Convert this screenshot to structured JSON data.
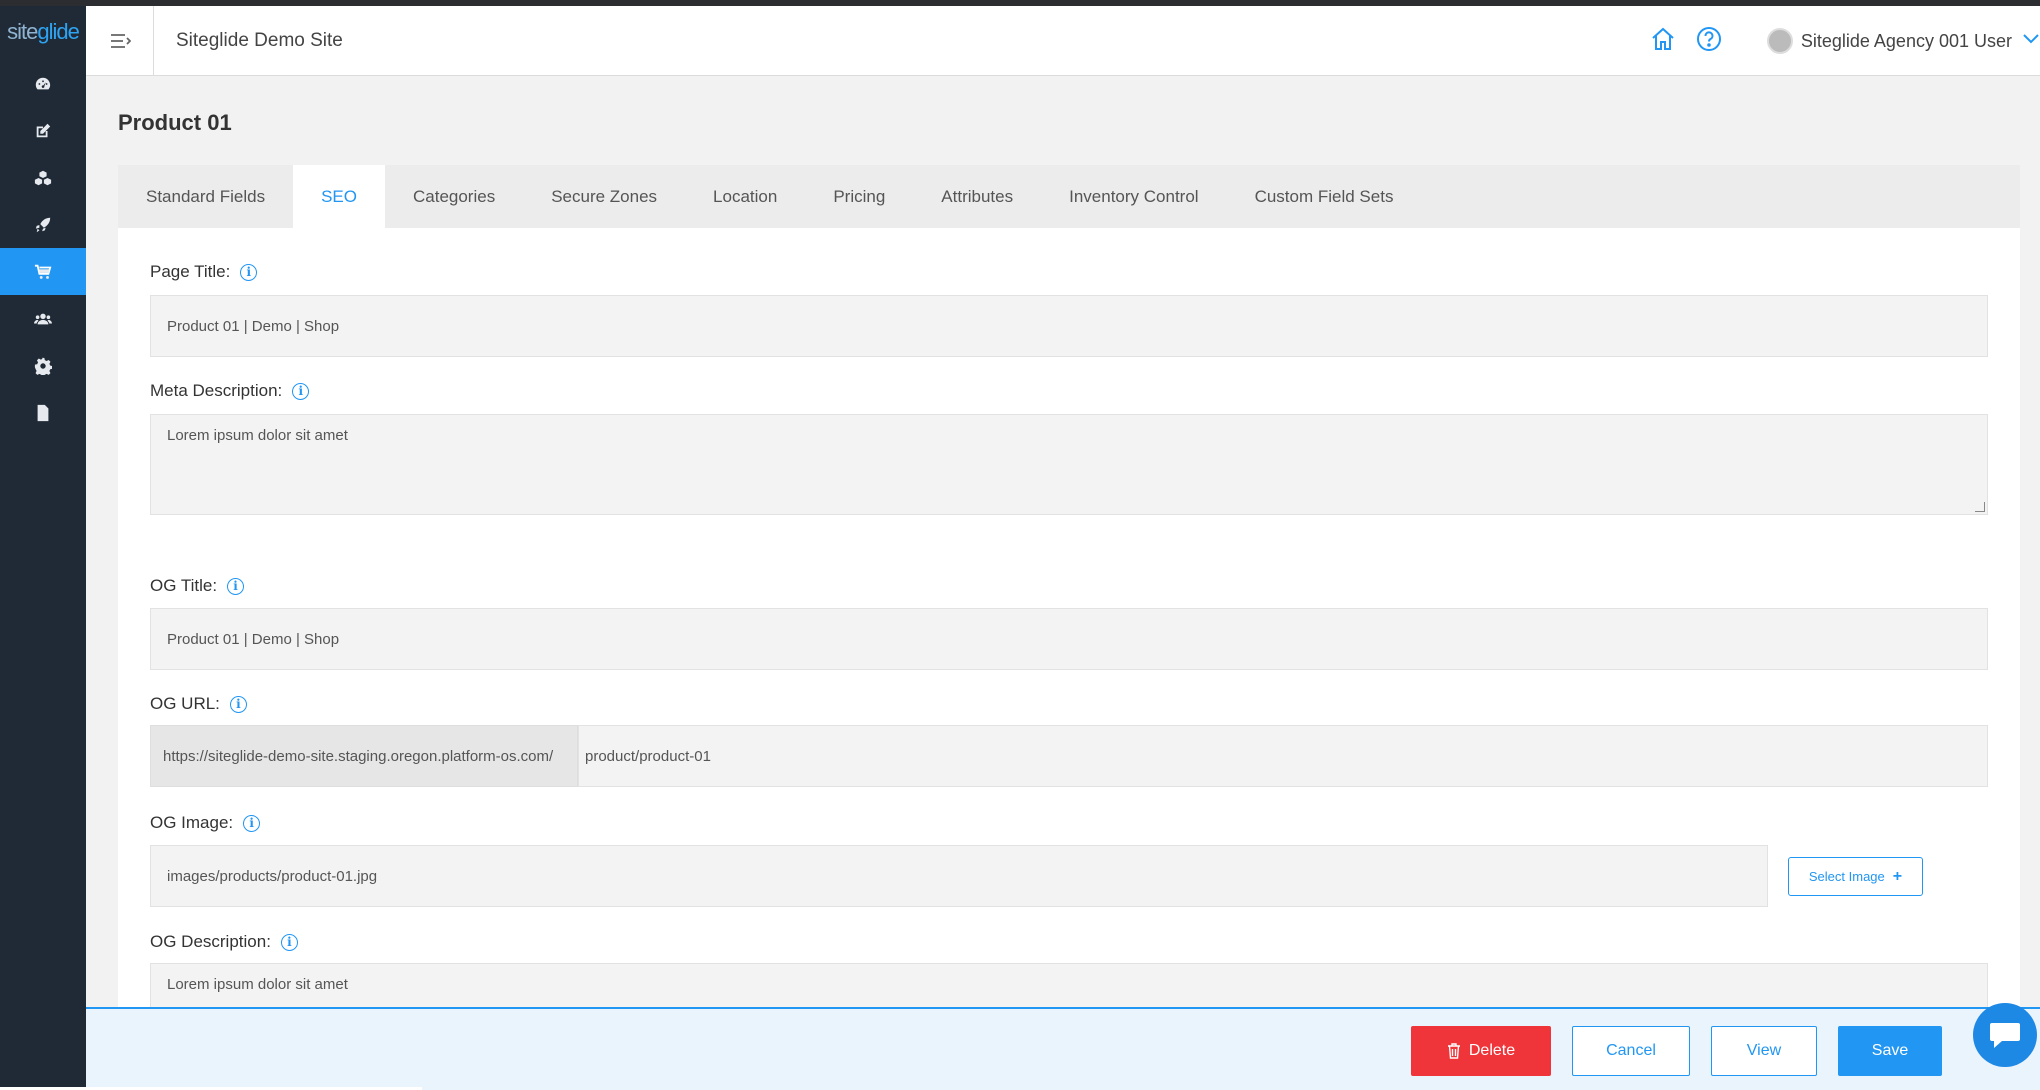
{
  "header": {
    "site_name": "Siteglide Demo Site",
    "user_name": "Siteglide Agency 001 User"
  },
  "logo": {
    "part1": "site",
    "part2": "glide"
  },
  "sidebar": {
    "items": [
      {
        "icon": "dashboard-icon"
      },
      {
        "icon": "edit-icon"
      },
      {
        "icon": "modules-icon"
      },
      {
        "icon": "rocket-icon"
      },
      {
        "icon": "cart-icon",
        "active": true
      },
      {
        "icon": "users-icon"
      },
      {
        "icon": "gear-icon"
      },
      {
        "icon": "document-icon"
      }
    ]
  },
  "page": {
    "title": "Product 01"
  },
  "tabs": [
    {
      "label": "Standard Fields"
    },
    {
      "label": "SEO",
      "active": true
    },
    {
      "label": "Categories"
    },
    {
      "label": "Secure Zones"
    },
    {
      "label": "Location"
    },
    {
      "label": "Pricing"
    },
    {
      "label": "Attributes"
    },
    {
      "label": "Inventory Control"
    },
    {
      "label": "Custom Field Sets"
    }
  ],
  "fields": {
    "page_title": {
      "label": "Page Title:",
      "value": "Product 01 | Demo | Shop"
    },
    "meta_description": {
      "label": "Meta Description:",
      "value": "Lorem ipsum dolor sit amet"
    },
    "og_title": {
      "label": "OG Title:",
      "value": "Product 01 | Demo | Shop"
    },
    "og_url": {
      "label": "OG URL:",
      "prefix": "https://siteglide-demo-site.staging.oregon.platform-os.com/",
      "value": "product/product-01"
    },
    "og_image": {
      "label": "OG Image:",
      "value": "images/products/product-01.jpg",
      "button": "Select Image"
    },
    "og_description": {
      "label": "OG Description:",
      "value": "Lorem ipsum dolor sit amet"
    }
  },
  "info_glyph": "i",
  "footer": {
    "delete": "Delete",
    "cancel": "Cancel",
    "view": "View",
    "save": "Save"
  },
  "colors": {
    "accent": "#2196f3",
    "danger": "#f0353a",
    "sidebar": "#1f2a36"
  }
}
